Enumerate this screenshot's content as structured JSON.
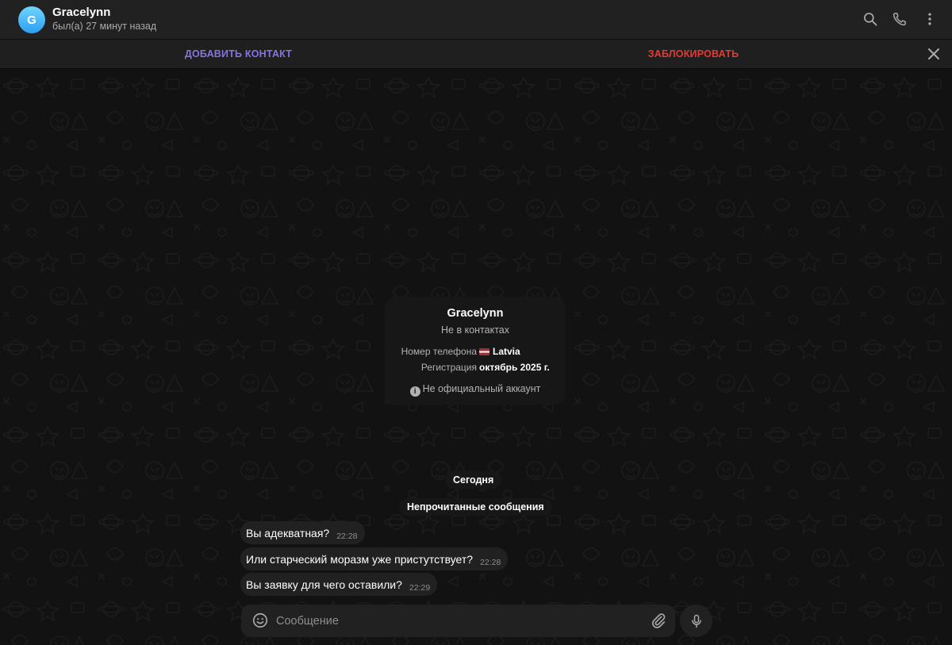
{
  "header": {
    "avatar_letter": "G",
    "peer_name": "Gracelynn",
    "peer_status": "был(а) 27 минут назад",
    "icons": [
      "search-icon",
      "phone-icon",
      "more-vertical-icon"
    ]
  },
  "action_bar": {
    "add_contact": "ДОБАВИТЬ КОНТАКТ",
    "block": "ЗАБЛОКИРОВАТЬ"
  },
  "info_card": {
    "name": "Gracelynn",
    "subtitle": "Не в контактах",
    "phone_label": "Номер телефона",
    "phone_value": "Latvia",
    "registration_label": "Регистрация",
    "registration_value": "октябрь 2025 г.",
    "official_note": "Не официальный аккаунт"
  },
  "separators": {
    "today": "Сегодня",
    "unread": "Непрочитанные сообщения"
  },
  "messages": [
    {
      "text": "Вы адекватная?",
      "time": "22:28"
    },
    {
      "text": "Или старческий моразм уже пристутствует?",
      "time": "22:28"
    },
    {
      "text": "Вы заявку для чего оставили?",
      "time": "22:29"
    }
  ],
  "composer": {
    "placeholder": "Сообщение"
  },
  "colors": {
    "accent": "#8774e1",
    "danger": "#e53935",
    "bubble": "#212121",
    "background": "#121212"
  }
}
